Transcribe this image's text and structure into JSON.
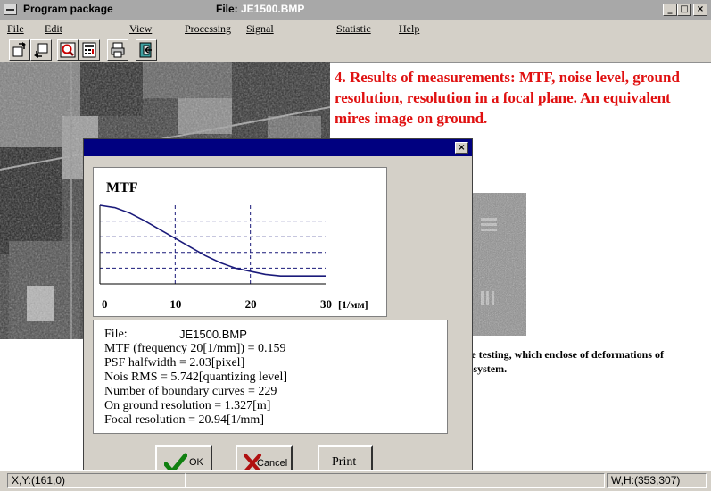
{
  "window": {
    "title": "Program package",
    "file_label": "File:",
    "file_name": "JE1500.BMP",
    "min_glyph": "_",
    "max_glyph": "□",
    "close_glyph": "×"
  },
  "menu": [
    "File",
    "Edit",
    "View",
    "Processing",
    "Signal",
    "Statistic",
    "Help"
  ],
  "toolbar": {
    "icons": [
      "open-file-icon",
      "save-file-icon",
      "zoom-icon",
      "calculator-icon",
      "print-icon",
      "exit-icon"
    ]
  },
  "heading": "4. Results of measurements: MTF, noise level, ground resolution, resolution in a focal plane. An equivalent mires image on ground.",
  "dialog": {
    "close_glyph": "×",
    "chart_title": "MTF",
    "info": {
      "file_label": "File:",
      "file_name": "JE1500.BMP",
      "lines": [
        "MTF (frequency 20[1/mm]) = 0.159",
        "PSF halfwidth  = 2.03[pixel]",
        "Nois RMS = 5.742[quantizing level]",
        "Number of boundary curves = 229",
        "On ground resolution = 1.327[m]",
        "Focal resolution = 20.94[1/mm]"
      ]
    },
    "buttons": {
      "ok": "OK",
      "cancel": "Cancel",
      "print": "Print"
    }
  },
  "chart_data": {
    "type": "line",
    "title": "MTF",
    "xlabel": "[1/мм]",
    "xlim": [
      0,
      30
    ],
    "ylim": [
      0,
      1
    ],
    "x_ticks": [
      "0",
      "10",
      "20",
      "30"
    ],
    "x": [
      0,
      2,
      4,
      6,
      8,
      10,
      12,
      14,
      16,
      18,
      20,
      22,
      24,
      26,
      28,
      30
    ],
    "y": [
      1.0,
      0.97,
      0.9,
      0.8,
      0.69,
      0.58,
      0.47,
      0.36,
      0.27,
      0.2,
      0.16,
      0.12,
      0.1,
      0.1,
      0.1,
      0.1
    ],
    "grid": true,
    "line_color": "#1a1a7a"
  },
  "caption": "Synthesis of  image testing,   which enclose of deformations of optical-electronic system.",
  "status": {
    "xy": "X,Y:(161,0)",
    "wh": "W,H:(353,307)"
  }
}
